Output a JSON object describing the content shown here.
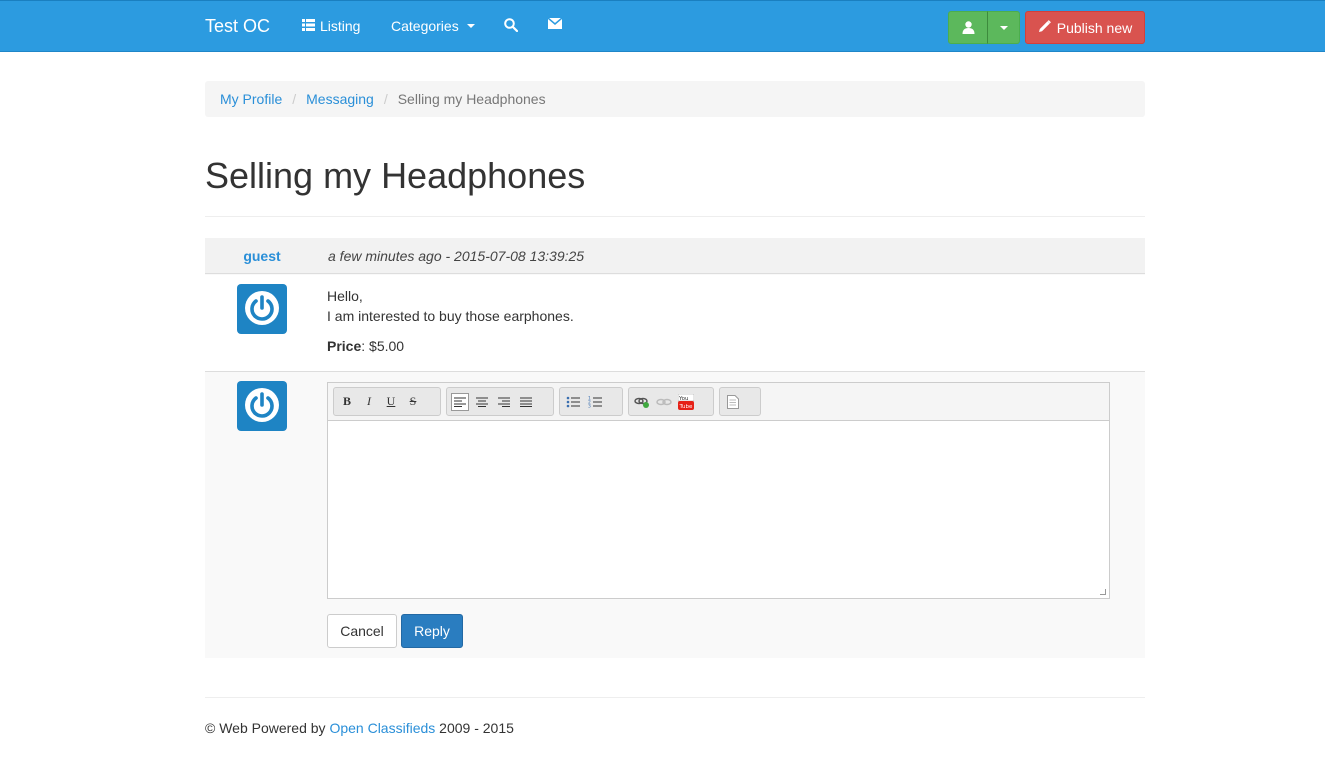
{
  "navbar": {
    "brand": "Test OC",
    "listing_label": "Listing",
    "categories_label": "Categories",
    "publish_label": "Publish new",
    "colors": {
      "bg": "#2c9be0",
      "user_btn": "#5cb85c",
      "publish_btn": "#d9534f"
    }
  },
  "breadcrumb": {
    "items": [
      "My Profile",
      "Messaging"
    ],
    "active": "Selling my Headphones",
    "separator": "/"
  },
  "page": {
    "title": "Selling my Headphones"
  },
  "message": {
    "author": "guest",
    "date": "a few minutes ago - 2015-07-08 13:39:25",
    "lines": [
      "Hello,",
      "I am interested to buy those earphones."
    ],
    "price_label": "Price",
    "price_value": ": $5.00"
  },
  "reply": {
    "cancel_label": "Cancel",
    "reply_label": "Reply",
    "toolbar_icons": [
      "bold-icon",
      "italic-icon",
      "underline-icon",
      "strikethrough-icon",
      "align-left-icon",
      "align-center-icon",
      "align-right-icon",
      "justify-icon",
      "bullet-list-icon",
      "numbered-list-icon",
      "link-icon",
      "unlink-icon",
      "youtube-icon",
      "source-icon"
    ]
  },
  "footer": {
    "prefix": "© Web Powered by",
    "link": "Open Classifieds",
    "suffix": "2009 - 2015"
  }
}
